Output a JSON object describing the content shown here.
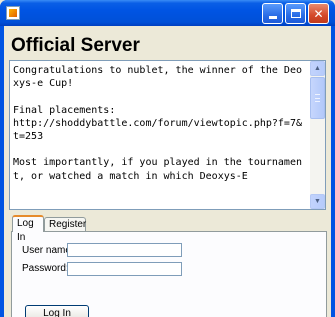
{
  "window": {
    "title": ""
  },
  "header": {
    "title": "Official Server"
  },
  "message": {
    "text": "Congratulations to nublet, the winner of the Deoxys-e Cup!\n\nFinal placements:\nhttp://shoddybattle.com/forum/viewtopic.php?f=7&t=253\n\nMost importantly, if you played in the tournament, or watched a match in which Deoxys-E"
  },
  "tabs": [
    {
      "label": "Log In",
      "selected": true
    },
    {
      "label": "Register",
      "selected": false
    }
  ],
  "login": {
    "username_label": "User name:",
    "username_value": "",
    "password_label": "Password:",
    "password_value": "",
    "submit_label": "Log In"
  },
  "colors": {
    "titlebar": "#0054e3",
    "window_bg": "#ece9d8",
    "tab_highlight": "#e68b2c"
  },
  "icons": {
    "app": "java-cup-icon",
    "minimize": "minimize-icon",
    "maximize": "maximize-icon",
    "close": "close-icon"
  }
}
